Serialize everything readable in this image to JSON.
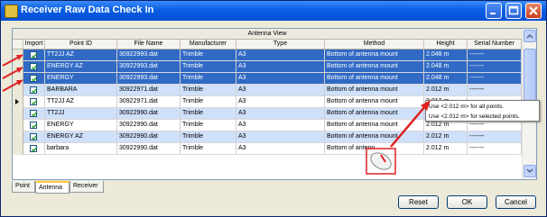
{
  "window": {
    "title": "Receiver Raw Data Check In",
    "colors": {
      "title_bar": "#0a5fe0",
      "selection": "#316ac5",
      "annotation": "#e02020"
    }
  },
  "grid": {
    "band_header": "Antenna View",
    "columns": [
      "Import",
      "Point ID",
      "File Name",
      "Manufacturer",
      "Type",
      "Method",
      "Height",
      "Serial Number"
    ],
    "rows": [
      {
        "state": "selected",
        "import": true,
        "point_id": "TT2JJ AZ",
        "file_name": "30922993.dat",
        "manufacturer": "Trimble",
        "type": "A3",
        "method": "Bottom of antenna mount",
        "height": "2.048 m",
        "serial": "-------"
      },
      {
        "state": "selected",
        "import": true,
        "point_id": "ENERGY AZ",
        "file_name": "30922993.dat",
        "manufacturer": "Trimble",
        "type": "A3",
        "method": "Bottom of antenna mount",
        "height": "2.048 m",
        "serial": "-------"
      },
      {
        "state": "selected",
        "import": true,
        "point_id": "ENERGY",
        "file_name": "30922993.dat",
        "manufacturer": "Trimble",
        "type": "A3",
        "method": "Bottom of antenna mount",
        "height": "2.048 m",
        "serial": "-------"
      },
      {
        "state": "normal",
        "import": true,
        "point_id": "BARBARA",
        "file_name": "30922971.dat",
        "manufacturer": "Trimble",
        "type": "A3",
        "method": "Bottom of antenna mount",
        "height": "2.012 m",
        "serial": "-------"
      },
      {
        "state": "current",
        "import": true,
        "point_id": "TT2JJ AZ",
        "file_name": "30922971.dat",
        "manufacturer": "Trimble",
        "type": "A3",
        "method": "Bottom of antenna mount",
        "height": "2.012 m",
        "serial": ""
      },
      {
        "state": "normal",
        "import": true,
        "point_id": "TT2JJ",
        "file_name": "30922990.dat",
        "manufacturer": "Trimble",
        "type": "A3",
        "method": "Bottom of antenna mount",
        "height": "",
        "serial": ""
      },
      {
        "state": "normal",
        "import": true,
        "point_id": "ENERGY",
        "file_name": "30922990.dat",
        "manufacturer": "Trimble",
        "type": "A3",
        "method": "Bottom of antenna mount",
        "height": "2.012 m",
        "serial": "-------"
      },
      {
        "state": "normal",
        "import": true,
        "point_id": "ENERGY AZ",
        "file_name": "30922990.dat",
        "manufacturer": "Trimble",
        "type": "A3",
        "method": "Bottom of antenna mount",
        "height": "2.012 m",
        "serial": "-------"
      },
      {
        "state": "normal",
        "import": true,
        "point_id": "barbara",
        "file_name": "30922990.dat",
        "manufacturer": "Trimble",
        "type": "A3",
        "method": "Bottom of antenn",
        "height": "2.012 m",
        "serial": "-------"
      }
    ]
  },
  "tooltip": {
    "line1": "Use <2.012 m> for all points.",
    "line2": "Use <2.012 m> for selected points."
  },
  "tabs": [
    "Point",
    "Antenna",
    "Receiver"
  ],
  "buttons": {
    "reset": "Reset",
    "ok": "OK",
    "cancel": "Cancel"
  },
  "icons": [
    "app-icon",
    "minimize-icon",
    "maximize-icon",
    "close-icon",
    "checkbox-checked-icon",
    "row-pointer-icon",
    "scroll-up-icon",
    "scroll-down-icon",
    "mouse-icon"
  ]
}
